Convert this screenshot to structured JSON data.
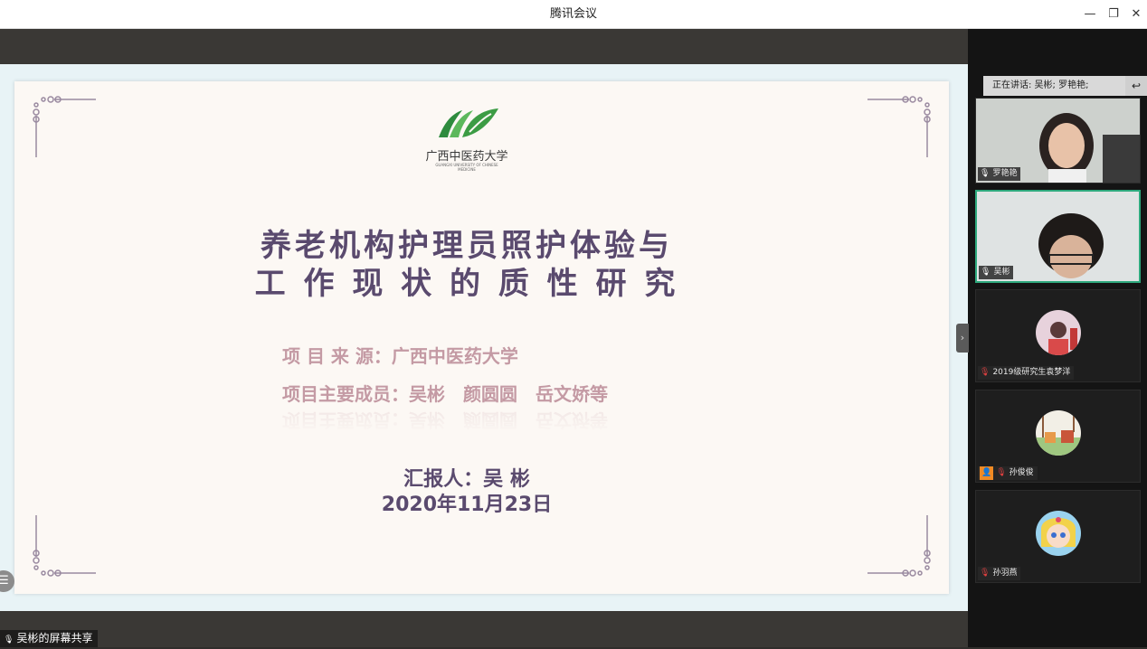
{
  "window": {
    "title": "腾讯会议",
    "minimize_icon": "—",
    "restore_icon": "❐",
    "close_icon": "✕"
  },
  "slide": {
    "logo_name": "广西中医药大学",
    "logo_sub": "GUANGXI UNIVERSITY OF CHINESE MEDICINE",
    "title_line1": "养老机构护理员照护体验与",
    "title_line2": "工 作 现 状 的 质 性 研 究",
    "source": "项 目 来 源：广西中医药大学",
    "members": "项目主要成员：吴彬　颜圆圆　岳文娇等",
    "reporter": "汇报人：吴 彬",
    "date": "2020年11月23日"
  },
  "share": {
    "label": "吴彬的屏幕共享"
  },
  "side_menu_icon": "☰",
  "panel": {
    "speaking_text": "正在讲话: 吴彬; 罗艳艳;",
    "back_icon": "↩",
    "expand_icon": "›",
    "participants": [
      {
        "name": "罗艳艳"
      },
      {
        "name": "吴彬"
      },
      {
        "name": "2019级研究生袁梦洋"
      },
      {
        "name": "孙俊俊"
      },
      {
        "name": "孙羽燕"
      }
    ]
  }
}
